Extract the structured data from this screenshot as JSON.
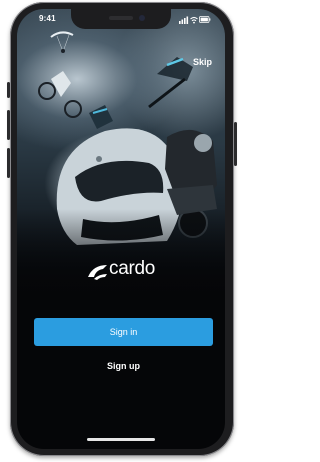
{
  "status_bar": {
    "time": "9:41"
  },
  "header": {
    "skip_label": "Skip"
  },
  "brand": {
    "logo_text": "cardo"
  },
  "actions": {
    "sign_in_label": "Sign in",
    "sign_up_label": "Sign up"
  },
  "colors": {
    "accent": "#2b9de0",
    "background": "#050608",
    "text": "#ffffff",
    "frame": "#1d1d1f"
  },
  "icons": [
    "signal-icon",
    "wifi-icon",
    "battery-icon",
    "cardo-logo-icon"
  ]
}
